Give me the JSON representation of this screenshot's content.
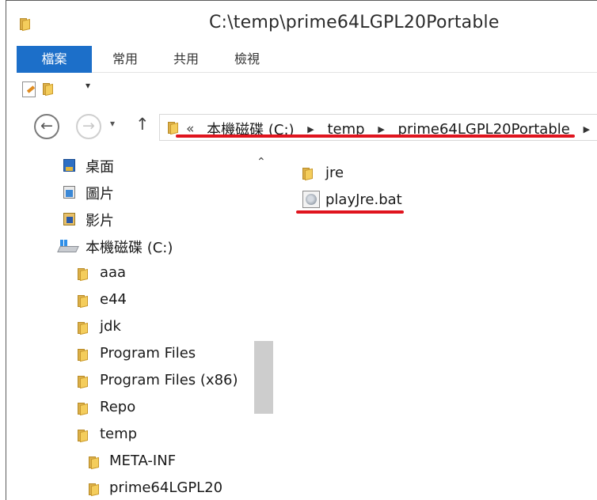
{
  "window": {
    "title": "C:\\temp\\prime64LGPL20Portable"
  },
  "ribbon": {
    "tabs": [
      "檔案",
      "常用",
      "共用",
      "檢視"
    ]
  },
  "quick_access": {
    "dropdown": "▾"
  },
  "nav_bar": {
    "back": "←",
    "forward": "→",
    "history": "▾",
    "up": "↑",
    "overflow": "«",
    "crumb_sep": "▶",
    "breadcrumbs": [
      "本機磁碟 (C:)",
      "temp",
      "prime64LGPL20Portable"
    ]
  },
  "nav_pane": {
    "collapse": "⌃",
    "quick": [
      {
        "label": "桌面",
        "icon": "desktop-icon"
      },
      {
        "label": "圖片",
        "icon": "pictures-icon"
      },
      {
        "label": "影片",
        "icon": "videos-icon"
      }
    ],
    "drive": {
      "label": "本機磁碟 (C:)",
      "icon": "drive-icon"
    },
    "folders": [
      "aaa",
      "e44",
      "jdk",
      "Program Files",
      "Program Files (x86)",
      "Repo",
      "temp"
    ],
    "subfolders": [
      "META-INF",
      "prime64LGPL20"
    ]
  },
  "content": {
    "items": [
      {
        "name": "jre",
        "type": "folder",
        "icon": "folder-icon"
      },
      {
        "name": "playJre.bat",
        "type": "batch-file",
        "icon": "batch-file-icon"
      }
    ]
  },
  "colors": {
    "accent": "#1c6fc9",
    "annotation": "#e0141e",
    "folder": "#f4cd5c"
  }
}
